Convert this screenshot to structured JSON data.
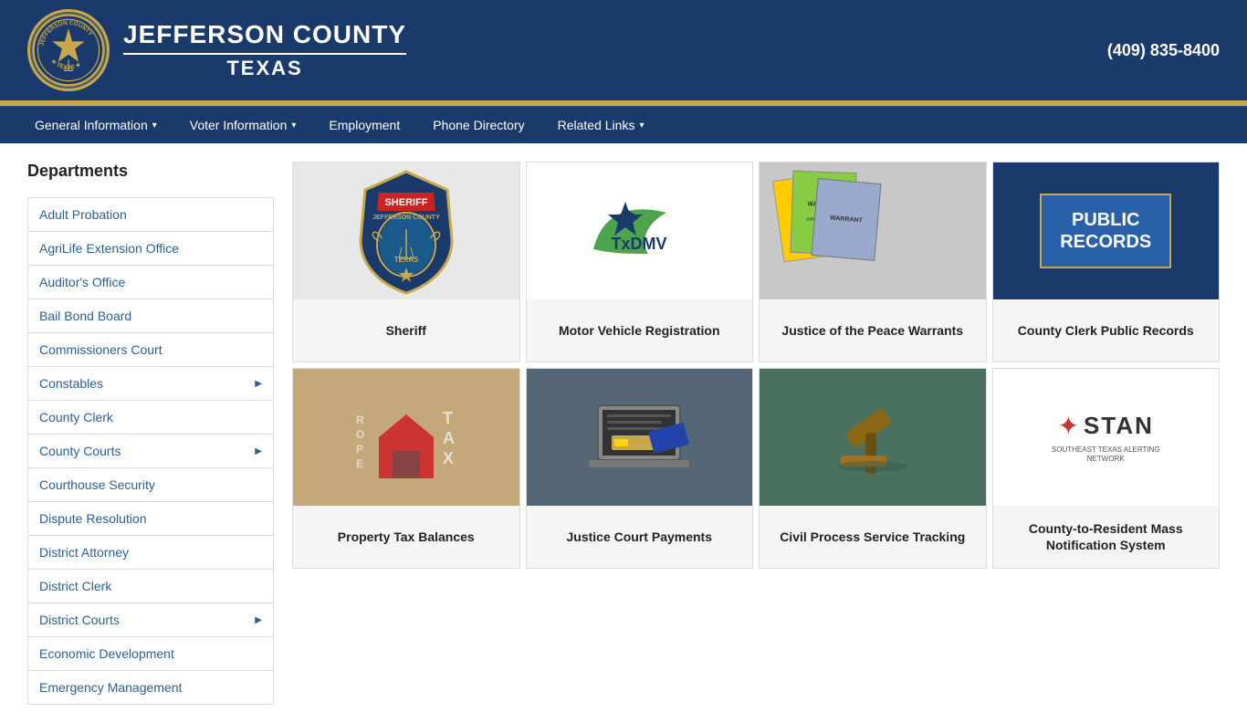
{
  "header": {
    "title_main": "JEFFERSON COUNTY",
    "title_sub": "TEXAS",
    "phone": "(409) 835-8400",
    "logo_alt": "Jefferson County Texas Seal"
  },
  "nav": {
    "items": [
      {
        "label": "General Information",
        "has_dropdown": true
      },
      {
        "label": "Voter Information",
        "has_dropdown": true
      },
      {
        "label": "Employment",
        "has_dropdown": false
      },
      {
        "label": "Phone Directory",
        "has_dropdown": false
      },
      {
        "label": "Related Links",
        "has_dropdown": true
      }
    ]
  },
  "sidebar": {
    "title": "Departments",
    "items": [
      {
        "label": "Adult Probation",
        "has_arrow": false
      },
      {
        "label": "AgriLife Extension Office",
        "has_arrow": false
      },
      {
        "label": "Auditor's Office",
        "has_arrow": false
      },
      {
        "label": "Bail Bond Board",
        "has_arrow": false
      },
      {
        "label": "Commissioners Court",
        "has_arrow": false
      },
      {
        "label": "Constables",
        "has_arrow": true
      },
      {
        "label": "County Clerk",
        "has_arrow": false
      },
      {
        "label": "County Courts",
        "has_arrow": true
      },
      {
        "label": "Courthouse Security",
        "has_arrow": false
      },
      {
        "label": "Dispute Resolution",
        "has_arrow": false
      },
      {
        "label": "District Attorney",
        "has_arrow": false
      },
      {
        "label": "District Clerk",
        "has_arrow": false
      },
      {
        "label": "District Courts",
        "has_arrow": true
      },
      {
        "label": "Economic Development",
        "has_arrow": false
      },
      {
        "label": "Emergency Management",
        "has_arrow": false
      }
    ]
  },
  "cards": [
    {
      "id": "sheriff",
      "label": "Sheriff",
      "type": "sheriff"
    },
    {
      "id": "motor-vehicle",
      "label": "Motor Vehicle Registration",
      "type": "txdmv"
    },
    {
      "id": "jp-warrants",
      "label": "Justice of the Peace Warrants",
      "type": "warrants"
    },
    {
      "id": "county-clerk-records",
      "label": "County Clerk Public Records",
      "type": "public-records"
    },
    {
      "id": "property-tax",
      "label": "Property Tax Balances",
      "type": "property-tax"
    },
    {
      "id": "justice-payments",
      "label": "Justice Court Payments",
      "type": "justice-pay"
    },
    {
      "id": "civil-process",
      "label": "Civil Process Service Tracking",
      "type": "civil-process"
    },
    {
      "id": "stan",
      "label": "County-to-Resident Mass Notification System",
      "type": "stan"
    }
  ],
  "stan": {
    "subtitle": "SOUTHEAST TEXAS ALERTING NETWORK"
  }
}
